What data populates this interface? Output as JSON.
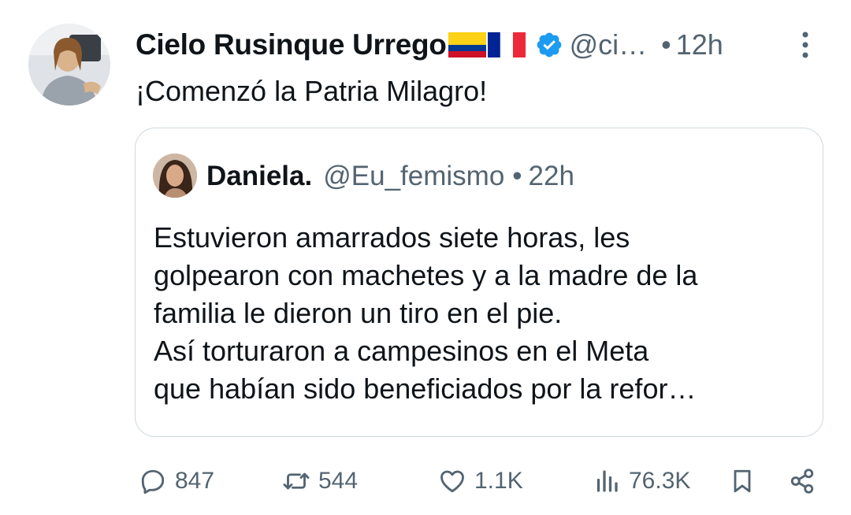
{
  "tweet": {
    "author_name": "Cielo Rusinque Urrego",
    "flags": [
      "colombia-flag",
      "france-flag"
    ],
    "verified_icon": "verified-badge-icon",
    "handle": "@ci…",
    "dot": "•",
    "time": "12h",
    "text": "¡Comenzó la Patria Milagro!"
  },
  "quote": {
    "author_name": "Daniela.",
    "handle": "@Eu_femismo",
    "dot": "•",
    "time": "22h",
    "lines": [
      "Estuvieron amarrados siete horas, les",
      "golpearon con machetes y a la madre de la",
      "familia le dieron un tiro en el pie.",
      "Así torturaron a campesinos en el Meta",
      "que habían sido beneficiados por la refor…"
    ]
  },
  "actions": {
    "replies": "847",
    "reposts": "544",
    "likes": "1.1K",
    "views": "76.3K"
  },
  "colors": {
    "text": "#0f1419",
    "secondary": "#536471",
    "border": "#cfd9de",
    "verified": "#1d9bf0"
  }
}
